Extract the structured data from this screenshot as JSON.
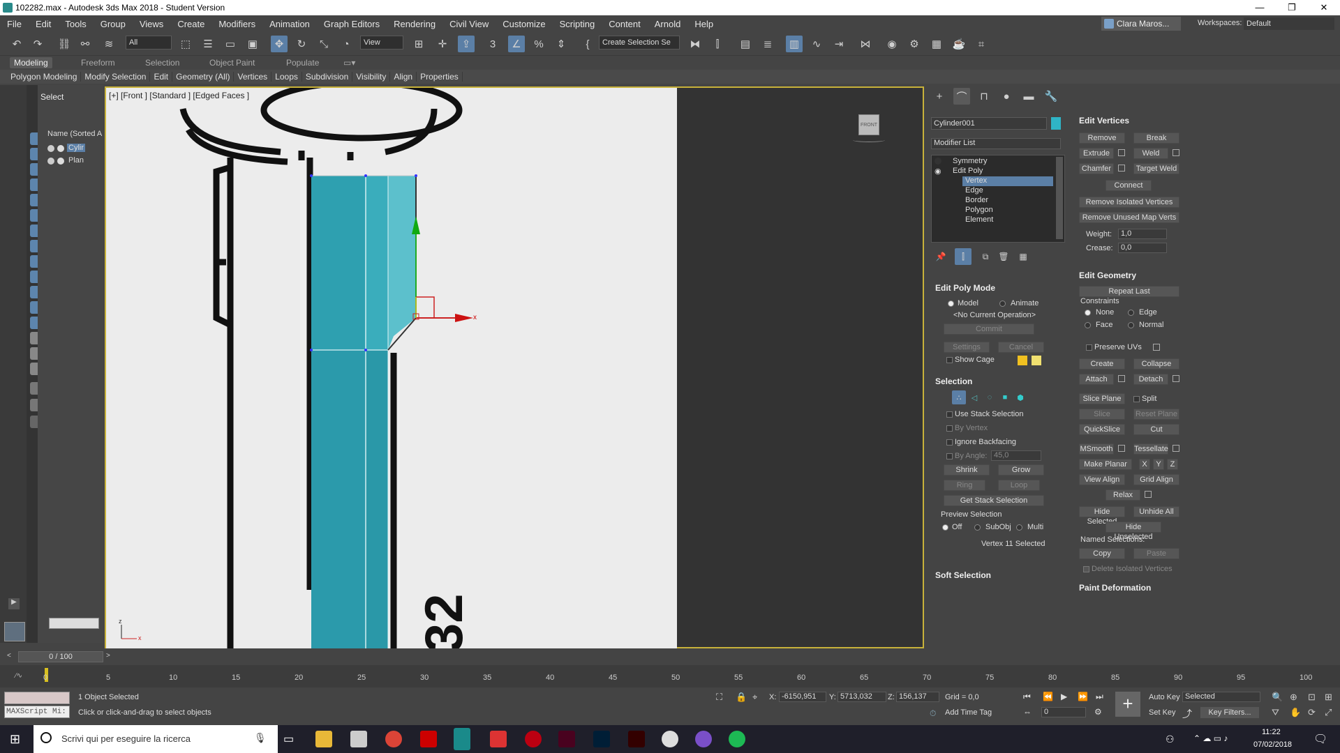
{
  "window": {
    "title": "102282.max - Autodesk 3ds Max 2018 - Student Version",
    "controls": [
      "—",
      "❐",
      "✕"
    ]
  },
  "menu": [
    "File",
    "Edit",
    "Tools",
    "Group",
    "Views",
    "Create",
    "Modifiers",
    "Animation",
    "Graph Editors",
    "Rendering",
    "Civil View",
    "Customize",
    "Scripting",
    "Content",
    "Arnold",
    "Help"
  ],
  "account": {
    "user": "Clara Maros...",
    "workspaces_label": "Workspaces:",
    "workspace": "Default"
  },
  "toolbar": {
    "filter": "All",
    "coord": "View",
    "named_selection": "Create Selection Se"
  },
  "ribbon": {
    "tabs": [
      "Modeling",
      "Freeform",
      "Selection",
      "Object Paint",
      "Populate"
    ],
    "items": [
      "Polygon Modeling",
      "Modify Selection",
      "Edit",
      "Geometry (All)",
      "Vertices",
      "Loops",
      "Subdivision",
      "Visibility",
      "Align",
      "Properties"
    ]
  },
  "scene_explorer": {
    "header": "Select",
    "column": "Name (Sorted A",
    "rows": [
      "Cylir",
      "Plan"
    ]
  },
  "viewport": {
    "label": "[+] [Front ] [Standard ] [Edged Faces ]",
    "viewcube": "FRONT",
    "ref_text": "32",
    "gizmo_x": "x",
    "axis_z": "z",
    "axis_x": "x"
  },
  "command_panel": {
    "object_name": "Cylinder001",
    "modifier_list": "Modifier List",
    "stack": [
      "Symmetry",
      "Edit Poly",
      "Vertex",
      "Edge",
      "Border",
      "Polygon",
      "Element"
    ],
    "edit_poly_mode": {
      "title": "Edit Poly Mode",
      "model": "Model",
      "animate": "Animate",
      "no_op": "<No Current Operation>",
      "commit": "Commit",
      "settings": "Settings",
      "cancel": "Cancel",
      "show_cage": "Show Cage"
    },
    "selection": {
      "title": "Selection",
      "use_stack": "Use Stack Selection",
      "by_vertex": "By Vertex",
      "ignore_backfacing": "Ignore Backfacing",
      "by_angle": "By Angle:",
      "by_angle_val": "45,0",
      "shrink": "Shrink",
      "grow": "Grow",
      "ring": "Ring",
      "loop": "Loop",
      "get_stack": "Get Stack Selection",
      "preview": "Preview Selection",
      "off": "Off",
      "subobj": "SubObj",
      "multi": "Multi",
      "status": "Vertex 11 Selected"
    },
    "soft_selection": "Soft Selection",
    "edit_vertices": {
      "title": "Edit Vertices",
      "remove": "Remove",
      "break": "Break",
      "extrude": "Extrude",
      "weld": "Weld",
      "chamfer": "Chamfer",
      "target_weld": "Target Weld",
      "connect": "Connect",
      "remove_isolated": "Remove Isolated Vertices",
      "remove_unused": "Remove Unused Map Verts",
      "weight_label": "Weight:",
      "weight": "1,0",
      "crease_label": "Crease:",
      "crease": "0,0"
    },
    "edit_geometry": {
      "title": "Edit Geometry",
      "repeat_last": "Repeat Last",
      "constraints": "Constraints",
      "none": "None",
      "edge": "Edge",
      "face": "Face",
      "normal": "Normal",
      "preserve_uvs": "Preserve UVs",
      "create": "Create",
      "collapse": "Collapse",
      "attach": "Attach",
      "detach": "Detach",
      "slice_plane": "Slice Plane",
      "split": "Split",
      "slice": "Slice",
      "reset_plane": "Reset Plane",
      "quickslice": "QuickSlice",
      "cut": "Cut",
      "msmooth": "MSmooth",
      "tessellate": "Tessellate",
      "make_planar": "Make Planar",
      "x": "X",
      "y": "Y",
      "z": "Z",
      "view_align": "View Align",
      "grid_align": "Grid Align",
      "relax": "Relax",
      "hide_selected": "Hide Selected",
      "unhide_all": "Unhide All",
      "hide_unselected": "Hide Unselected",
      "named_selections": "Named Selections:",
      "copy": "Copy",
      "paste": "Paste",
      "delete_isolated": "Delete Isolated Vertices"
    },
    "paint_deformation": "Paint Deformation"
  },
  "timeline": {
    "frame": "0 / 100",
    "ticks": [
      "0",
      "5",
      "10",
      "15",
      "20",
      "25",
      "30",
      "35",
      "40",
      "45",
      "50",
      "55",
      "60",
      "65",
      "70",
      "75",
      "80",
      "85",
      "90",
      "95",
      "100"
    ]
  },
  "status": {
    "maxscript": "MAXScript Mi:",
    "selected": "1 Object Selected",
    "prompt": "Click or click-and-drag to select objects",
    "x_label": "X:",
    "x": "-6150,951",
    "y_label": "Y:",
    "y": "5713,032",
    "z_label": "Z:",
    "z": "156,137",
    "grid": "Grid = 0,0",
    "add_time_tag": "Add Time Tag",
    "auto_key": "Auto Key",
    "set_key": "Set Key",
    "selected_dd": "Selected",
    "key_filters": "Key Filters...",
    "frame_field": "0"
  },
  "taskbar": {
    "search": "Scrivi qui per eseguire la ricerca",
    "time": "11:22",
    "date": "07/02/2018"
  },
  "colors": {
    "accent": "#5b7fa6",
    "viewport_border": "#c8b23a",
    "mesh": "#3aa9b8"
  }
}
